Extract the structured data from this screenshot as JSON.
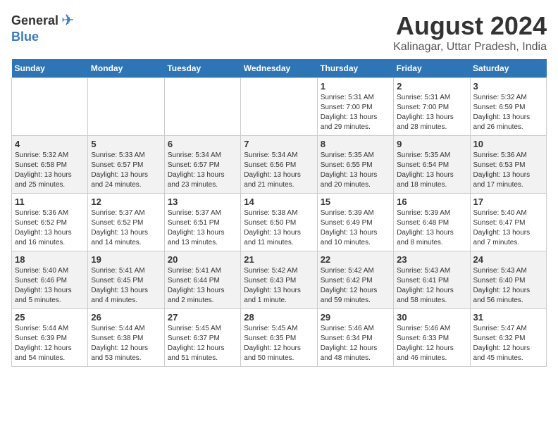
{
  "header": {
    "logo_general": "General",
    "logo_blue": "Blue",
    "month_year": "August 2024",
    "location": "Kalinagar, Uttar Pradesh, India"
  },
  "days_of_week": [
    "Sunday",
    "Monday",
    "Tuesday",
    "Wednesday",
    "Thursday",
    "Friday",
    "Saturday"
  ],
  "weeks": [
    [
      {
        "day": "",
        "info": ""
      },
      {
        "day": "",
        "info": ""
      },
      {
        "day": "",
        "info": ""
      },
      {
        "day": "",
        "info": ""
      },
      {
        "day": "1",
        "info": "Sunrise: 5:31 AM\nSunset: 7:00 PM\nDaylight: 13 hours\nand 29 minutes."
      },
      {
        "day": "2",
        "info": "Sunrise: 5:31 AM\nSunset: 7:00 PM\nDaylight: 13 hours\nand 28 minutes."
      },
      {
        "day": "3",
        "info": "Sunrise: 5:32 AM\nSunset: 6:59 PM\nDaylight: 13 hours\nand 26 minutes."
      }
    ],
    [
      {
        "day": "4",
        "info": "Sunrise: 5:32 AM\nSunset: 6:58 PM\nDaylight: 13 hours\nand 25 minutes."
      },
      {
        "day": "5",
        "info": "Sunrise: 5:33 AM\nSunset: 6:57 PM\nDaylight: 13 hours\nand 24 minutes."
      },
      {
        "day": "6",
        "info": "Sunrise: 5:34 AM\nSunset: 6:57 PM\nDaylight: 13 hours\nand 23 minutes."
      },
      {
        "day": "7",
        "info": "Sunrise: 5:34 AM\nSunset: 6:56 PM\nDaylight: 13 hours\nand 21 minutes."
      },
      {
        "day": "8",
        "info": "Sunrise: 5:35 AM\nSunset: 6:55 PM\nDaylight: 13 hours\nand 20 minutes."
      },
      {
        "day": "9",
        "info": "Sunrise: 5:35 AM\nSunset: 6:54 PM\nDaylight: 13 hours\nand 18 minutes."
      },
      {
        "day": "10",
        "info": "Sunrise: 5:36 AM\nSunset: 6:53 PM\nDaylight: 13 hours\nand 17 minutes."
      }
    ],
    [
      {
        "day": "11",
        "info": "Sunrise: 5:36 AM\nSunset: 6:52 PM\nDaylight: 13 hours\nand 16 minutes."
      },
      {
        "day": "12",
        "info": "Sunrise: 5:37 AM\nSunset: 6:52 PM\nDaylight: 13 hours\nand 14 minutes."
      },
      {
        "day": "13",
        "info": "Sunrise: 5:37 AM\nSunset: 6:51 PM\nDaylight: 13 hours\nand 13 minutes."
      },
      {
        "day": "14",
        "info": "Sunrise: 5:38 AM\nSunset: 6:50 PM\nDaylight: 13 hours\nand 11 minutes."
      },
      {
        "day": "15",
        "info": "Sunrise: 5:39 AM\nSunset: 6:49 PM\nDaylight: 13 hours\nand 10 minutes."
      },
      {
        "day": "16",
        "info": "Sunrise: 5:39 AM\nSunset: 6:48 PM\nDaylight: 13 hours\nand 8 minutes."
      },
      {
        "day": "17",
        "info": "Sunrise: 5:40 AM\nSunset: 6:47 PM\nDaylight: 13 hours\nand 7 minutes."
      }
    ],
    [
      {
        "day": "18",
        "info": "Sunrise: 5:40 AM\nSunset: 6:46 PM\nDaylight: 13 hours\nand 5 minutes."
      },
      {
        "day": "19",
        "info": "Sunrise: 5:41 AM\nSunset: 6:45 PM\nDaylight: 13 hours\nand 4 minutes."
      },
      {
        "day": "20",
        "info": "Sunrise: 5:41 AM\nSunset: 6:44 PM\nDaylight: 13 hours\nand 2 minutes."
      },
      {
        "day": "21",
        "info": "Sunrise: 5:42 AM\nSunset: 6:43 PM\nDaylight: 13 hours\nand 1 minute."
      },
      {
        "day": "22",
        "info": "Sunrise: 5:42 AM\nSunset: 6:42 PM\nDaylight: 12 hours\nand 59 minutes."
      },
      {
        "day": "23",
        "info": "Sunrise: 5:43 AM\nSunset: 6:41 PM\nDaylight: 12 hours\nand 58 minutes."
      },
      {
        "day": "24",
        "info": "Sunrise: 5:43 AM\nSunset: 6:40 PM\nDaylight: 12 hours\nand 56 minutes."
      }
    ],
    [
      {
        "day": "25",
        "info": "Sunrise: 5:44 AM\nSunset: 6:39 PM\nDaylight: 12 hours\nand 54 minutes."
      },
      {
        "day": "26",
        "info": "Sunrise: 5:44 AM\nSunset: 6:38 PM\nDaylight: 12 hours\nand 53 minutes."
      },
      {
        "day": "27",
        "info": "Sunrise: 5:45 AM\nSunset: 6:37 PM\nDaylight: 12 hours\nand 51 minutes."
      },
      {
        "day": "28",
        "info": "Sunrise: 5:45 AM\nSunset: 6:35 PM\nDaylight: 12 hours\nand 50 minutes."
      },
      {
        "day": "29",
        "info": "Sunrise: 5:46 AM\nSunset: 6:34 PM\nDaylight: 12 hours\nand 48 minutes."
      },
      {
        "day": "30",
        "info": "Sunrise: 5:46 AM\nSunset: 6:33 PM\nDaylight: 12 hours\nand 46 minutes."
      },
      {
        "day": "31",
        "info": "Sunrise: 5:47 AM\nSunset: 6:32 PM\nDaylight: 12 hours\nand 45 minutes."
      }
    ]
  ]
}
